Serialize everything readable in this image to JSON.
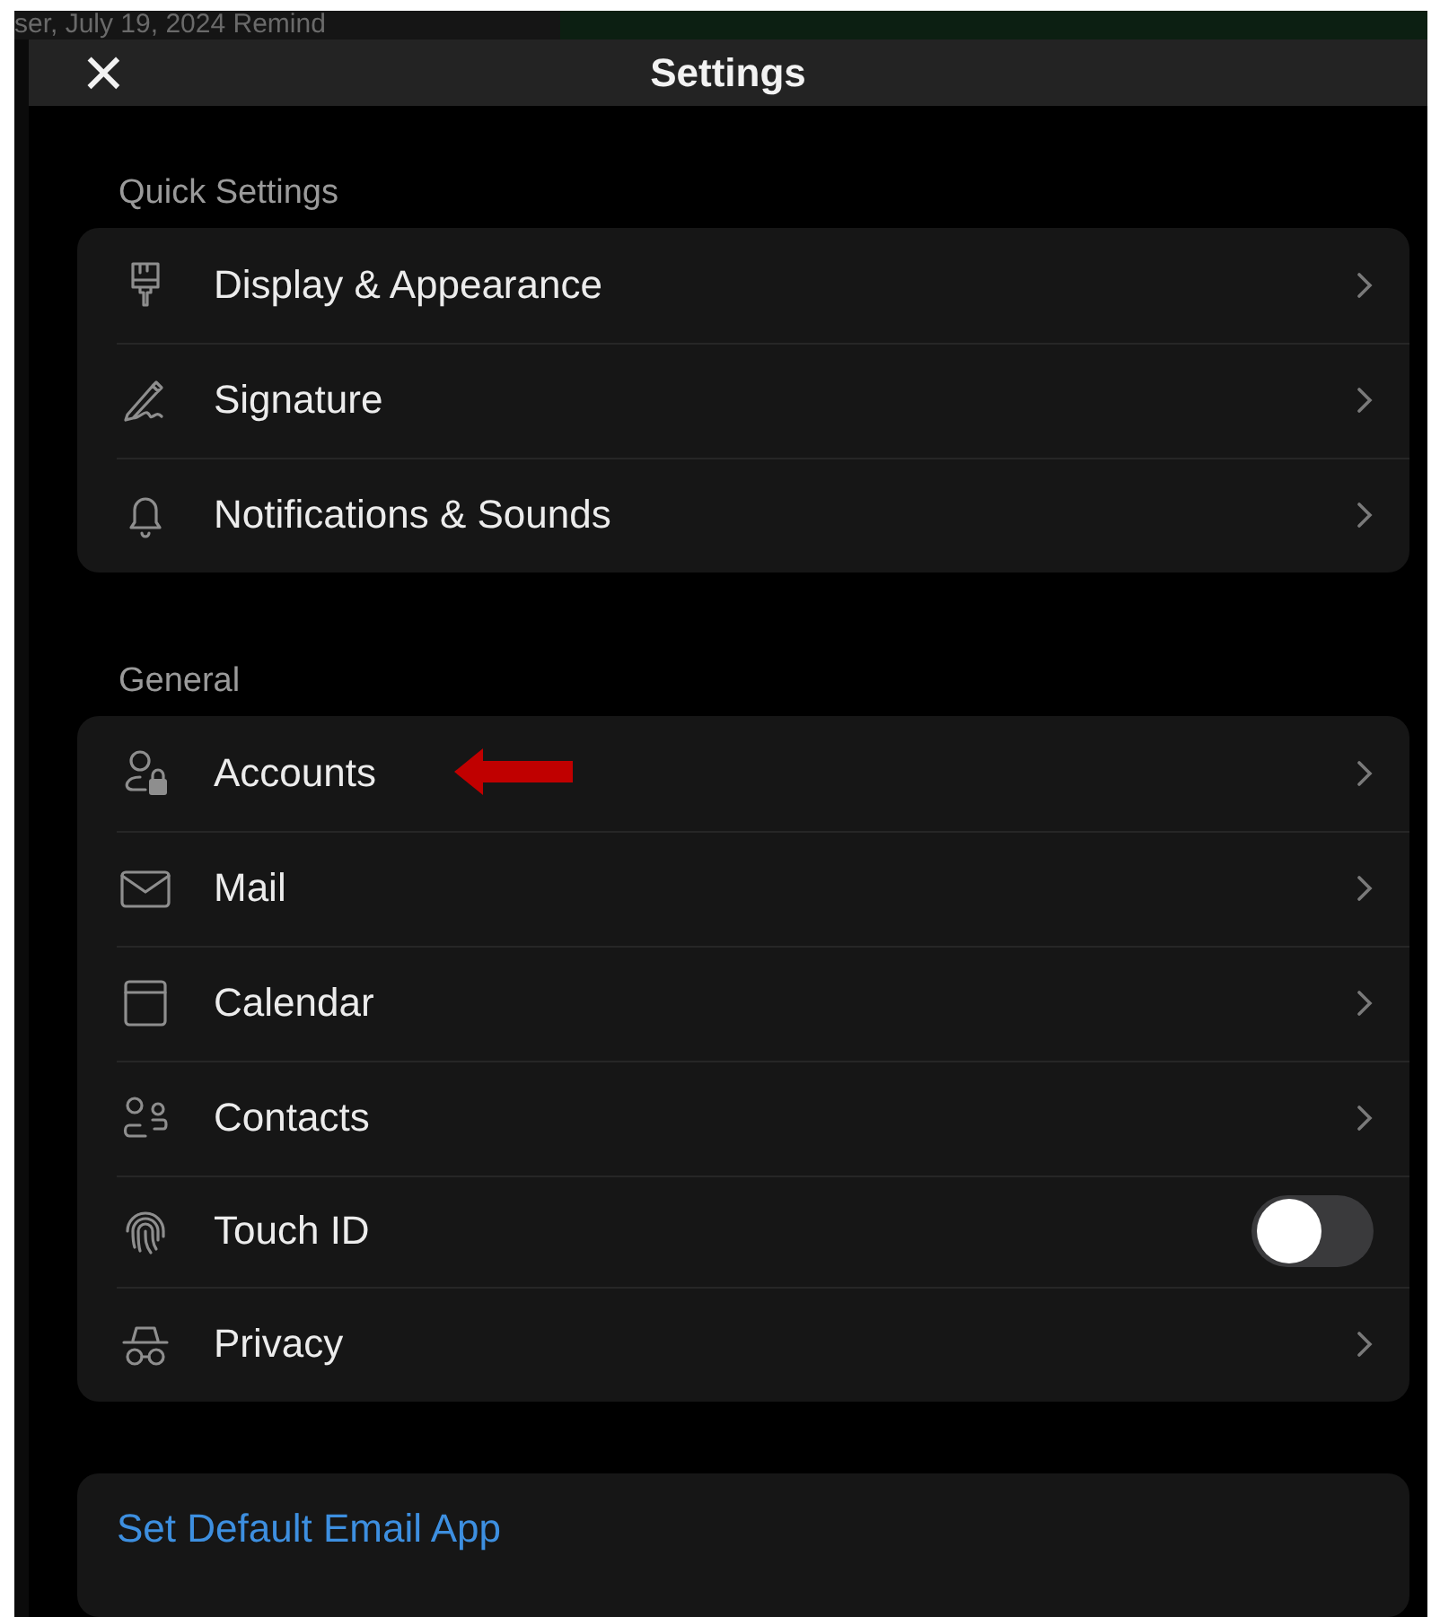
{
  "background": {
    "text": "ser, July 19, 2024 Remind"
  },
  "header": {
    "close": "×",
    "title": "Settings"
  },
  "sections": [
    {
      "title": "Quick Settings",
      "items": [
        {
          "kind": "link",
          "label": "Display & Appearance"
        },
        {
          "kind": "link",
          "label": "Signature"
        },
        {
          "kind": "link",
          "label": "Notifications & Sounds"
        }
      ]
    },
    {
      "title": "General",
      "items": [
        {
          "kind": "link",
          "label": "Accounts",
          "annotated": true
        },
        {
          "kind": "link",
          "label": "Mail"
        },
        {
          "kind": "link",
          "label": "Calendar"
        },
        {
          "kind": "link",
          "label": "Contacts"
        },
        {
          "kind": "toggle",
          "label": "Touch ID",
          "on": false
        },
        {
          "kind": "link",
          "label": "Privacy"
        }
      ]
    }
  ],
  "default_app_link": "Set Default Email App"
}
